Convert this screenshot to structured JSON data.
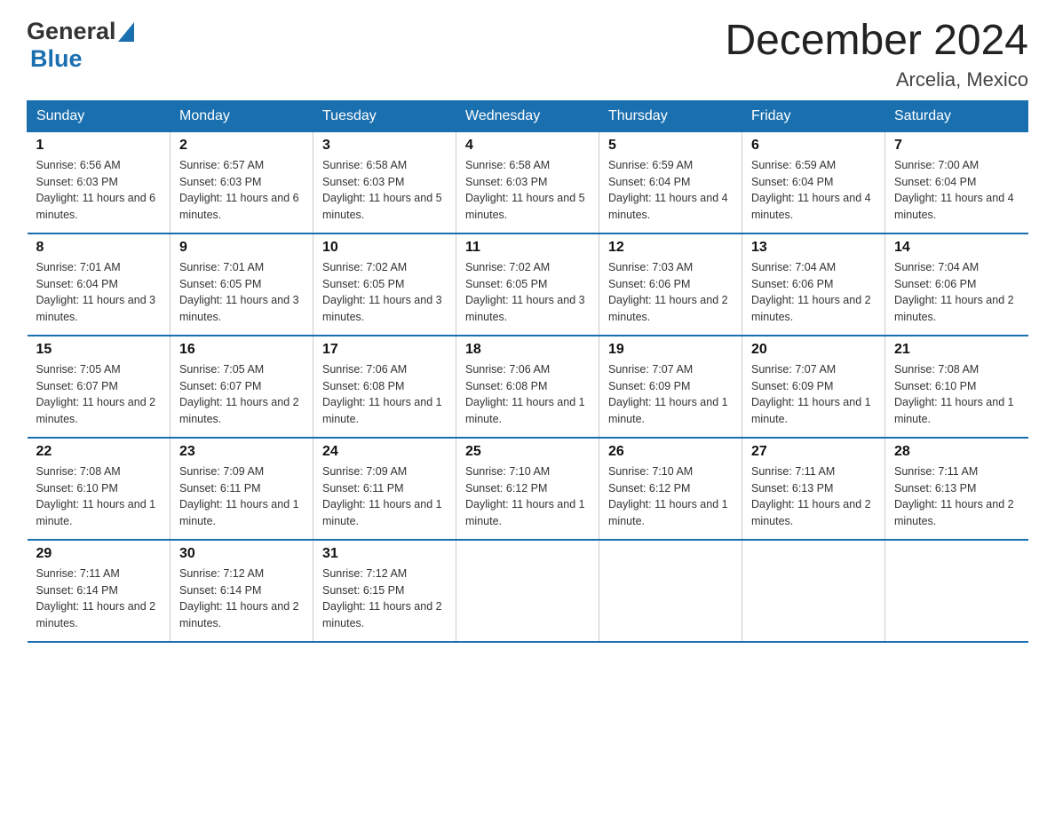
{
  "header": {
    "logo_general": "General",
    "logo_blue": "Blue",
    "main_title": "December 2024",
    "subtitle": "Arcelia, Mexico"
  },
  "days_of_week": [
    "Sunday",
    "Monday",
    "Tuesday",
    "Wednesday",
    "Thursday",
    "Friday",
    "Saturday"
  ],
  "weeks": [
    [
      {
        "day": "1",
        "sunrise": "6:56 AM",
        "sunset": "6:03 PM",
        "daylight": "11 hours and 6 minutes."
      },
      {
        "day": "2",
        "sunrise": "6:57 AM",
        "sunset": "6:03 PM",
        "daylight": "11 hours and 6 minutes."
      },
      {
        "day": "3",
        "sunrise": "6:58 AM",
        "sunset": "6:03 PM",
        "daylight": "11 hours and 5 minutes."
      },
      {
        "day": "4",
        "sunrise": "6:58 AM",
        "sunset": "6:03 PM",
        "daylight": "11 hours and 5 minutes."
      },
      {
        "day": "5",
        "sunrise": "6:59 AM",
        "sunset": "6:04 PM",
        "daylight": "11 hours and 4 minutes."
      },
      {
        "day": "6",
        "sunrise": "6:59 AM",
        "sunset": "6:04 PM",
        "daylight": "11 hours and 4 minutes."
      },
      {
        "day": "7",
        "sunrise": "7:00 AM",
        "sunset": "6:04 PM",
        "daylight": "11 hours and 4 minutes."
      }
    ],
    [
      {
        "day": "8",
        "sunrise": "7:01 AM",
        "sunset": "6:04 PM",
        "daylight": "11 hours and 3 minutes."
      },
      {
        "day": "9",
        "sunrise": "7:01 AM",
        "sunset": "6:05 PM",
        "daylight": "11 hours and 3 minutes."
      },
      {
        "day": "10",
        "sunrise": "7:02 AM",
        "sunset": "6:05 PM",
        "daylight": "11 hours and 3 minutes."
      },
      {
        "day": "11",
        "sunrise": "7:02 AM",
        "sunset": "6:05 PM",
        "daylight": "11 hours and 3 minutes."
      },
      {
        "day": "12",
        "sunrise": "7:03 AM",
        "sunset": "6:06 PM",
        "daylight": "11 hours and 2 minutes."
      },
      {
        "day": "13",
        "sunrise": "7:04 AM",
        "sunset": "6:06 PM",
        "daylight": "11 hours and 2 minutes."
      },
      {
        "day": "14",
        "sunrise": "7:04 AM",
        "sunset": "6:06 PM",
        "daylight": "11 hours and 2 minutes."
      }
    ],
    [
      {
        "day": "15",
        "sunrise": "7:05 AM",
        "sunset": "6:07 PM",
        "daylight": "11 hours and 2 minutes."
      },
      {
        "day": "16",
        "sunrise": "7:05 AM",
        "sunset": "6:07 PM",
        "daylight": "11 hours and 2 minutes."
      },
      {
        "day": "17",
        "sunrise": "7:06 AM",
        "sunset": "6:08 PM",
        "daylight": "11 hours and 1 minute."
      },
      {
        "day": "18",
        "sunrise": "7:06 AM",
        "sunset": "6:08 PM",
        "daylight": "11 hours and 1 minute."
      },
      {
        "day": "19",
        "sunrise": "7:07 AM",
        "sunset": "6:09 PM",
        "daylight": "11 hours and 1 minute."
      },
      {
        "day": "20",
        "sunrise": "7:07 AM",
        "sunset": "6:09 PM",
        "daylight": "11 hours and 1 minute."
      },
      {
        "day": "21",
        "sunrise": "7:08 AM",
        "sunset": "6:10 PM",
        "daylight": "11 hours and 1 minute."
      }
    ],
    [
      {
        "day": "22",
        "sunrise": "7:08 AM",
        "sunset": "6:10 PM",
        "daylight": "11 hours and 1 minute."
      },
      {
        "day": "23",
        "sunrise": "7:09 AM",
        "sunset": "6:11 PM",
        "daylight": "11 hours and 1 minute."
      },
      {
        "day": "24",
        "sunrise": "7:09 AM",
        "sunset": "6:11 PM",
        "daylight": "11 hours and 1 minute."
      },
      {
        "day": "25",
        "sunrise": "7:10 AM",
        "sunset": "6:12 PM",
        "daylight": "11 hours and 1 minute."
      },
      {
        "day": "26",
        "sunrise": "7:10 AM",
        "sunset": "6:12 PM",
        "daylight": "11 hours and 1 minute."
      },
      {
        "day": "27",
        "sunrise": "7:11 AM",
        "sunset": "6:13 PM",
        "daylight": "11 hours and 2 minutes."
      },
      {
        "day": "28",
        "sunrise": "7:11 AM",
        "sunset": "6:13 PM",
        "daylight": "11 hours and 2 minutes."
      }
    ],
    [
      {
        "day": "29",
        "sunrise": "7:11 AM",
        "sunset": "6:14 PM",
        "daylight": "11 hours and 2 minutes."
      },
      {
        "day": "30",
        "sunrise": "7:12 AM",
        "sunset": "6:14 PM",
        "daylight": "11 hours and 2 minutes."
      },
      {
        "day": "31",
        "sunrise": "7:12 AM",
        "sunset": "6:15 PM",
        "daylight": "11 hours and 2 minutes."
      },
      null,
      null,
      null,
      null
    ]
  ],
  "labels": {
    "sunrise": "Sunrise:",
    "sunset": "Sunset:",
    "daylight": "Daylight:"
  }
}
